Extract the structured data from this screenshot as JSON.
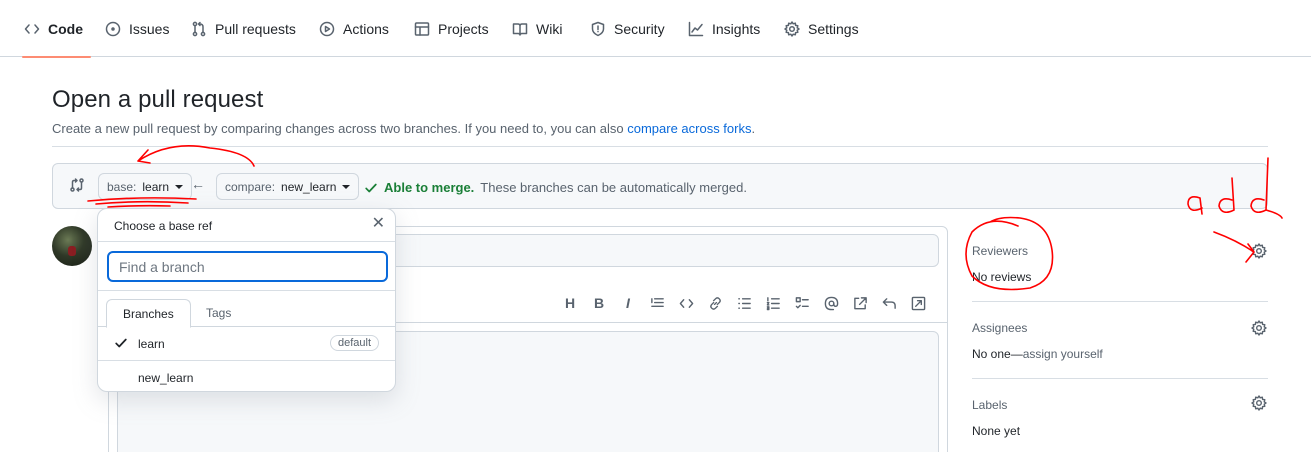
{
  "nav": {
    "tabs": [
      {
        "label": "Code",
        "icon": "code-icon"
      },
      {
        "label": "Issues",
        "icon": "issues-icon"
      },
      {
        "label": "Pull requests",
        "icon": "pull-request-icon"
      },
      {
        "label": "Actions",
        "icon": "play-icon"
      },
      {
        "label": "Projects",
        "icon": "table-icon"
      },
      {
        "label": "Wiki",
        "icon": "book-icon"
      },
      {
        "label": "Security",
        "icon": "shield-icon"
      },
      {
        "label": "Insights",
        "icon": "graph-icon"
      },
      {
        "label": "Settings",
        "icon": "gear-icon"
      }
    ],
    "active": "Code"
  },
  "page": {
    "title": "Open a pull request",
    "subtitle": "Create a new pull request by comparing changes across two branches. If you need to, you can also ",
    "subtitle_link": "compare across forks",
    "subtitle_end": "."
  },
  "compare": {
    "base_prefix": "base:",
    "base_branch": "learn",
    "compare_prefix": "compare:",
    "compare_branch": "new_learn",
    "merge_ok": "Able to merge.",
    "merge_msg": "These branches can be automatically merged."
  },
  "dropdown": {
    "title": "Choose a base ref",
    "filter_placeholder": "Find a branch",
    "tabs": [
      "Branches",
      "Tags"
    ],
    "items": [
      {
        "name": "learn",
        "selected": true,
        "badge": "default"
      },
      {
        "name": "new_learn",
        "selected": false,
        "badge": ""
      }
    ]
  },
  "sidebar": {
    "reviewers": {
      "label": "Reviewers",
      "value": "No reviews"
    },
    "assignees": {
      "label": "Assignees",
      "value": "No one—",
      "action": "assign yourself"
    },
    "labels": {
      "label": "Labels",
      "value": "None yet"
    }
  },
  "annotation": {
    "text": "add",
    "color": "#ff0000"
  }
}
